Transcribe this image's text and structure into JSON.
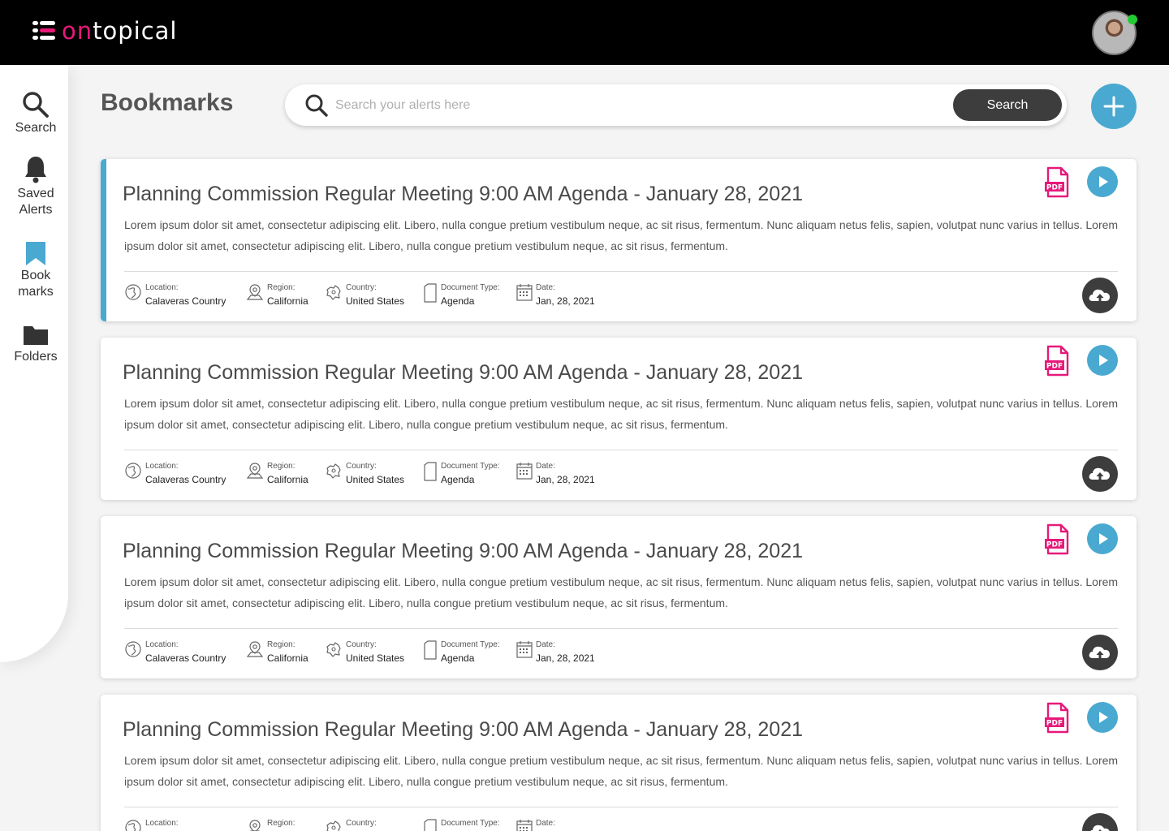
{
  "brand": {
    "part1": "on",
    "part2": "topical"
  },
  "colors": {
    "accent": "#4aa9d0",
    "brand_pink": "#e6197a",
    "online_status": "#22cc33",
    "dark_button": "#3d3d3d"
  },
  "user": {
    "avatar_alt": "user-avatar"
  },
  "sidebar": {
    "items": [
      {
        "icon": "search-icon",
        "line1": "Search",
        "line2": ""
      },
      {
        "icon": "bell-icon",
        "line1": "Saved",
        "line2": "Alerts"
      },
      {
        "icon": "bookmark-icon",
        "line1": "Book",
        "line2": "marks"
      },
      {
        "icon": "folder-icon",
        "line1": "Folders",
        "line2": ""
      }
    ],
    "active_index": 2
  },
  "header": {
    "title": "Bookmarks",
    "search_placeholder": "Search your alerts here",
    "search_button": "Search",
    "add_button_icon": "plus-icon"
  },
  "cards": [
    {
      "title": "Planning Commission Regular Meeting 9:00 AM Agenda - January 28, 2021",
      "description": "Lorem ipsum dolor sit amet, consectetur adipiscing elit. Libero, nulla congue pretium vestibulum neque, ac sit risus, fermentum. Nunc aliquam netus felis, sapien, volutpat nunc varius in tellus. Lorem ipsum dolor sit amet, consectetur adipiscing elit. Libero, nulla congue pretium vestibulum neque, ac sit risus, fermentum.",
      "meta": {
        "location_label": "Location:",
        "location": "Calaveras Country",
        "region_label": "Region:",
        "region": "California",
        "country_label": "Country:",
        "country": "United States",
        "doctype_label": "Document Type:",
        "doctype": "Agenda",
        "date_label": "Date:",
        "date": "Jan, 28, 2021"
      },
      "pdf_label": "PDF"
    },
    {
      "title": "Planning Commission Regular Meeting 9:00 AM Agenda - January 28, 2021",
      "description": "Lorem ipsum dolor sit amet, consectetur adipiscing elit. Libero, nulla congue pretium vestibulum neque, ac sit risus, fermentum. Nunc aliquam netus felis, sapien, volutpat nunc varius in tellus. Lorem ipsum dolor sit amet, consectetur adipiscing elit. Libero, nulla congue pretium vestibulum neque, ac sit risus, fermentum.",
      "meta": {
        "location_label": "Location:",
        "location": "Calaveras Country",
        "region_label": "Region:",
        "region": "California",
        "country_label": "Country:",
        "country": "United States",
        "doctype_label": "Document Type:",
        "doctype": "Agenda",
        "date_label": "Date:",
        "date": "Jan, 28, 2021"
      },
      "pdf_label": "PDF"
    },
    {
      "title": "Planning Commission Regular Meeting 9:00 AM Agenda - January 28, 2021",
      "description": "Lorem ipsum dolor sit amet, consectetur adipiscing elit. Libero, nulla congue pretium vestibulum neque, ac sit risus, fermentum. Nunc aliquam netus felis, sapien, volutpat nunc varius in tellus. Lorem ipsum dolor sit amet, consectetur adipiscing elit. Libero, nulla congue pretium vestibulum neque, ac sit risus, fermentum.",
      "meta": {
        "location_label": "Location:",
        "location": "Calaveras Country",
        "region_label": "Region:",
        "region": "California",
        "country_label": "Country:",
        "country": "United States",
        "doctype_label": "Document Type:",
        "doctype": "Agenda",
        "date_label": "Date:",
        "date": "Jan, 28, 2021"
      },
      "pdf_label": "PDF"
    },
    {
      "title": "Planning Commission Regular Meeting 9:00 AM Agenda - January 28, 2021",
      "description": "Lorem ipsum dolor sit amet, consectetur adipiscing elit. Libero, nulla congue pretium vestibulum neque, ac sit risus, fermentum. Nunc aliquam netus felis, sapien, volutpat nunc varius in tellus. Lorem ipsum dolor sit amet, consectetur adipiscing elit. Libero, nulla congue pretium vestibulum neque, ac sit risus, fermentum.",
      "meta": {
        "location_label": "Location:",
        "location": "",
        "region_label": "Region:",
        "region": "",
        "country_label": "Country:",
        "country": "",
        "doctype_label": "Document Type:",
        "doctype": "",
        "date_label": "Date:",
        "date": ""
      },
      "pdf_label": "PDF"
    }
  ]
}
